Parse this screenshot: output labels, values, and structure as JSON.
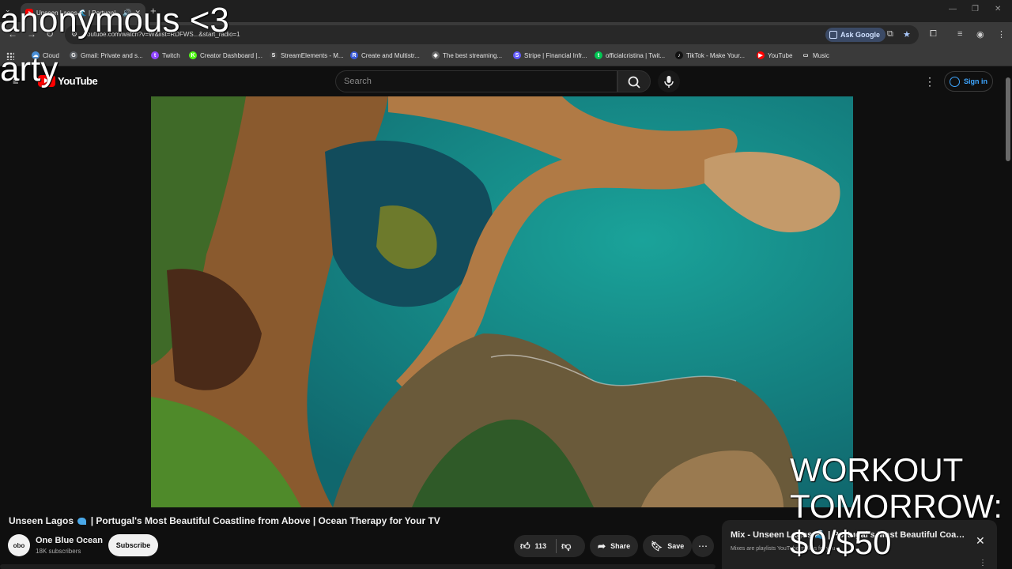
{
  "browser": {
    "tab_title": "Unseen Lagos 🌊 | Portugal",
    "url": "youtube.com/watch?v=W&list=RDFWS...&start_radio=1",
    "ask_google": "Ask Google",
    "bookmarks": [
      {
        "label": "Cloud",
        "color": "#4a90d9",
        "glyph": "☁"
      },
      {
        "label": "Gmail: Private and s...",
        "color": "#5f6368",
        "glyph": "G"
      },
      {
        "label": "Twitch",
        "color": "#9146ff",
        "glyph": "t"
      },
      {
        "label": "Creator Dashboard |...",
        "color": "#53fc18",
        "glyph": "K"
      },
      {
        "label": "StreamElements - M...",
        "color": "#444444",
        "glyph": "S"
      },
      {
        "label": "Create and Multistr...",
        "color": "#3b5bdb",
        "glyph": "R"
      },
      {
        "label": "The best streaming...",
        "color": "#666666",
        "glyph": "◆"
      },
      {
        "label": "Stripe | Financial Infr...",
        "color": "#635bff",
        "glyph": "S"
      },
      {
        "label": "officialcristina | Twit...",
        "color": "#00c853",
        "glyph": "t"
      },
      {
        "label": "TikTok - Make Your...",
        "color": "#111111",
        "glyph": "♪"
      },
      {
        "label": "YouTube",
        "color": "#ff0000",
        "glyph": "▶"
      },
      {
        "label": "Music",
        "color": "transparent",
        "glyph": "▭"
      }
    ]
  },
  "youtube": {
    "logo_text": "YouTube",
    "search_placeholder": "Search",
    "sign_in": "Sign in"
  },
  "video": {
    "title_part1": "Unseen Lagos",
    "title_part2": "| Portugal's Most Beautiful Coastline from Above | Ocean Therapy for Your TV",
    "channel_name": "One Blue Ocean",
    "channel_avatar_text": "obo",
    "subscribers": "18K subscribers",
    "subscribe_label": "Subscribe",
    "likes": "113",
    "share_label": "Share",
    "save_label": "Save"
  },
  "mix": {
    "title": "Mix - Unseen Lagos 🌊 | Portugal's Most Beautiful Coastline from Above",
    "subtitle": "Mixes are playlists YouTube makes for you"
  },
  "overlays": {
    "name": "anonymous <3",
    "party": "arty",
    "goal_line1": "WORKOUT",
    "goal_line2": "TOMORROW:",
    "goal_line3": "$0/$50"
  }
}
